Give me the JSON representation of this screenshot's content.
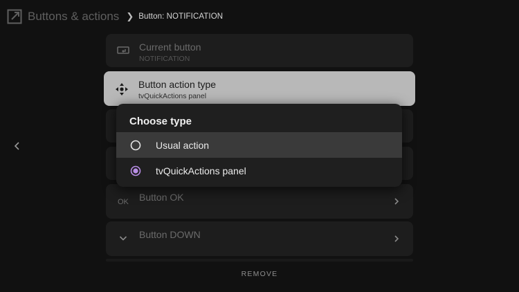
{
  "header": {
    "title": "Buttons & actions",
    "breadcrumb": "Button: NOTIFICATION"
  },
  "settings": {
    "current_button": {
      "label": "Current button",
      "value": "NOTIFICATION"
    },
    "action_type": {
      "label": "Button action type",
      "value": "tvQuickActions panel"
    },
    "button_ok": {
      "icon_text": "OK",
      "label": "Button OK"
    },
    "button_down": {
      "label": "Button DOWN"
    }
  },
  "footer": {
    "remove_label": "REMOVE"
  },
  "dialog": {
    "title": "Choose type",
    "options": [
      {
        "label": "Usual action",
        "selected": false,
        "focused": true
      },
      {
        "label": "tvQuickActions panel",
        "selected": true,
        "focused": false
      }
    ]
  },
  "colors": {
    "accent": "#b98ee6",
    "background": "#111111",
    "focus_card": "#b8b8b8"
  }
}
